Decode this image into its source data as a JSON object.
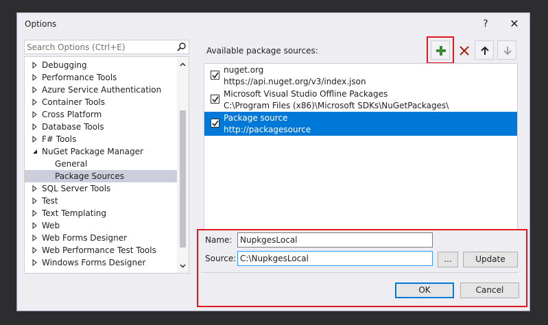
{
  "window": {
    "title": "Options",
    "help_glyph": "?",
    "close_glyph": "✕"
  },
  "search": {
    "placeholder": "Search Options (Ctrl+E)"
  },
  "tree": {
    "items": [
      {
        "label": "Debugging",
        "level": 0,
        "expander": "collapsed"
      },
      {
        "label": "Performance Tools",
        "level": 0,
        "expander": "collapsed"
      },
      {
        "label": "Azure Service Authentication",
        "level": 0,
        "expander": "collapsed"
      },
      {
        "label": "Container Tools",
        "level": 0,
        "expander": "collapsed"
      },
      {
        "label": "Cross Platform",
        "level": 0,
        "expander": "collapsed"
      },
      {
        "label": "Database Tools",
        "level": 0,
        "expander": "collapsed"
      },
      {
        "label": "F# Tools",
        "level": 0,
        "expander": "collapsed"
      },
      {
        "label": "NuGet Package Manager",
        "level": 0,
        "expander": "expanded"
      },
      {
        "label": "General",
        "level": 1,
        "expander": "none"
      },
      {
        "label": "Package Sources",
        "level": 1,
        "expander": "none",
        "selected": true
      },
      {
        "label": "SQL Server Tools",
        "level": 0,
        "expander": "collapsed"
      },
      {
        "label": "Test",
        "level": 0,
        "expander": "collapsed"
      },
      {
        "label": "Text Templating",
        "level": 0,
        "expander": "collapsed"
      },
      {
        "label": "Web",
        "level": 0,
        "expander": "collapsed"
      },
      {
        "label": "Web Forms Designer",
        "level": 0,
        "expander": "collapsed"
      },
      {
        "label": "Web Performance Test Tools",
        "level": 0,
        "expander": "collapsed"
      },
      {
        "label": "Windows Forms Designer",
        "level": 0,
        "expander": "collapsed"
      }
    ]
  },
  "sources": {
    "heading": "Available package sources:",
    "items": [
      {
        "name": "nuget.org",
        "url": "https://api.nuget.org/v3/index.json",
        "checked": true
      },
      {
        "name": "Microsoft Visual Studio Offline Packages",
        "url": "C:\\Program Files (x86)\\Microsoft SDKs\\NuGetPackages\\",
        "checked": true
      },
      {
        "name": "Package source",
        "url": "http://packagesource",
        "checked": true,
        "selected": true
      }
    ]
  },
  "form": {
    "name_label": "Name:",
    "name_value": "NupkgesLocal",
    "source_label": "Source:",
    "source_value": "C:\\NupkgesLocal",
    "browse_label": "...",
    "update_label": "Update"
  },
  "footer": {
    "ok_label": "OK",
    "cancel_label": "Cancel"
  },
  "colors": {
    "selection": "#0078d7",
    "tree_selection": "#cccedb",
    "highlight": "#e3161f",
    "add_icon": "#388a34",
    "remove_icon": "#a1260d"
  }
}
